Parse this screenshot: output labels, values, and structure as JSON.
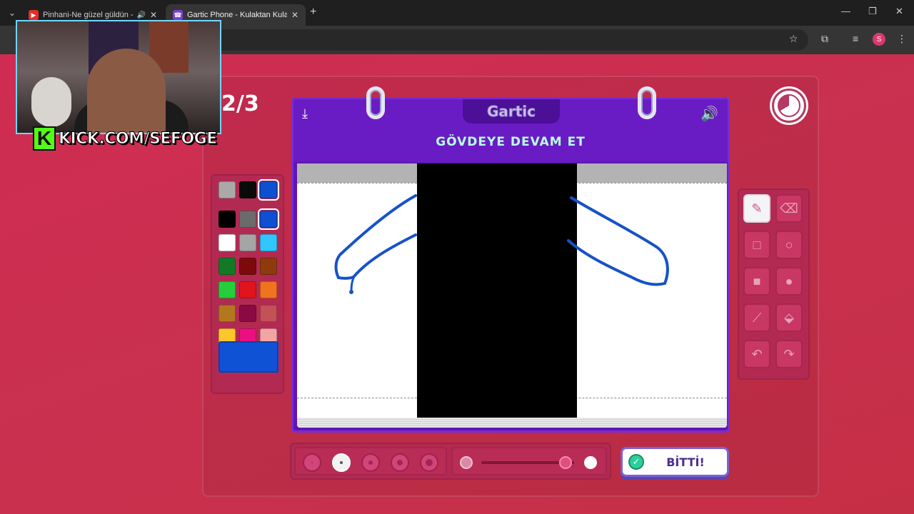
{
  "browser": {
    "tabs": [
      {
        "title": "Pinhani-Ne güzel güldün -",
        "favicon": "youtube-icon",
        "state": "inactive",
        "audio": true
      },
      {
        "title": "Gartic Phone - Kulaktan Kulağa",
        "favicon": "phone-icon",
        "state": "active",
        "audio": false
      }
    ],
    "profile_initial": "S"
  },
  "stream_overlay": {
    "kick_logo": "K",
    "kick_text": "KICK.COM/SEFOGE"
  },
  "game": {
    "round": "2/3",
    "logo": "Gartic",
    "prompt": "GÖVDEYE DEVAM ET",
    "done_label": "BİTTİ!",
    "timer_progress": 0.33,
    "palette": [
      {
        "color": "#a9a9a9"
      },
      {
        "color": "#0a0a0a"
      },
      {
        "color": "#0f4fd1",
        "selected": true
      },
      {
        "color": "#000000"
      },
      {
        "color": "#6b6b6b"
      },
      {
        "color": "#0f4fd1",
        "selected": true
      },
      {
        "color": "#ffffff"
      },
      {
        "color": "#a5a5a5"
      },
      {
        "color": "#31c6ff"
      },
      {
        "color": "#127a24"
      },
      {
        "color": "#7d0a0a"
      },
      {
        "color": "#8d3a0c"
      },
      {
        "color": "#23cf3b"
      },
      {
        "color": "#e1131b"
      },
      {
        "color": "#f07320"
      },
      {
        "color": "#b1781f"
      },
      {
        "color": "#8a0b43"
      },
      {
        "color": "#c45058"
      },
      {
        "color": "#fbc72a"
      },
      {
        "color": "#ec0f82"
      },
      {
        "color": "#f3a4a4"
      }
    ],
    "current_color": "#0f52d6",
    "tools": [
      {
        "name": "pencil-tool",
        "icon": "✎",
        "active": true
      },
      {
        "name": "eraser-tool",
        "icon": "⌫"
      },
      {
        "name": "rectangle-outline-tool",
        "icon": "□"
      },
      {
        "name": "ellipse-outline-tool",
        "icon": "○"
      },
      {
        "name": "rectangle-fill-tool",
        "icon": "■"
      },
      {
        "name": "ellipse-fill-tool",
        "icon": "●"
      },
      {
        "name": "line-tool",
        "icon": "⟋"
      },
      {
        "name": "fill-bucket-tool",
        "icon": "⬙"
      },
      {
        "name": "undo-tool",
        "icon": "↶"
      },
      {
        "name": "redo-tool",
        "icon": "↷"
      }
    ],
    "brush_sizes": [
      {
        "size": 2
      },
      {
        "size": 4,
        "active": true
      },
      {
        "size": 6
      },
      {
        "size": 8
      },
      {
        "size": 10
      }
    ],
    "opacity_value": 0.85
  }
}
